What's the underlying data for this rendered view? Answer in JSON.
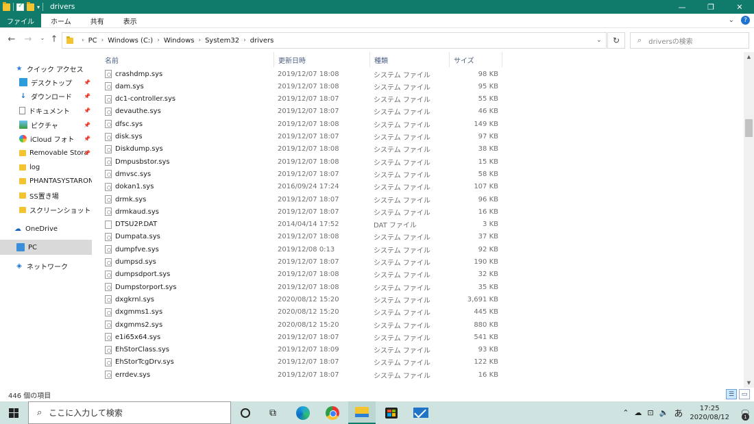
{
  "window": {
    "title": "drivers",
    "minimize": "—",
    "restore": "❐",
    "close": "✕"
  },
  "ribbon": {
    "tabs": [
      "ファイル",
      "ホーム",
      "共有",
      "表示"
    ]
  },
  "address": {
    "crumbs": [
      "PC",
      "Windows (C:)",
      "Windows",
      "System32",
      "drivers"
    ],
    "search_placeholder": "driversの検索"
  },
  "sidebar": {
    "items": [
      {
        "label": "クイック アクセス",
        "icon": "star-icon"
      },
      {
        "label": "デスクトップ",
        "icon": "desktop-icon",
        "pinned": true
      },
      {
        "label": "ダウンロード",
        "icon": "download-icon",
        "pinned": true
      },
      {
        "label": "ドキュメント",
        "icon": "document-icon",
        "pinned": true
      },
      {
        "label": "ピクチャ",
        "icon": "pictures-icon",
        "pinned": true
      },
      {
        "label": "iCloud フォト",
        "icon": "icloud-photos-icon",
        "pinned": true
      },
      {
        "label": "Removable Stora",
        "icon": "folder-icon",
        "pinned": true
      },
      {
        "label": "log",
        "icon": "folder-icon"
      },
      {
        "label": "PHANTASYSTARON",
        "icon": "folder-icon"
      },
      {
        "label": "SS置き場",
        "icon": "folder-icon"
      },
      {
        "label": "スクリーンショット",
        "icon": "folder-icon"
      },
      {
        "label": "OneDrive",
        "icon": "onedrive-icon"
      },
      {
        "label": "PC",
        "icon": "pc-icon",
        "selected": true
      },
      {
        "label": "ネットワーク",
        "icon": "network-icon"
      }
    ]
  },
  "columns": {
    "name": "名前",
    "date": "更新日時",
    "type": "種類",
    "size": "サイズ"
  },
  "files": [
    {
      "name": "crashdmp.sys",
      "date": "2019/12/07 18:08",
      "type": "システム ファイル",
      "size": "98 KB"
    },
    {
      "name": "dam.sys",
      "date": "2019/12/07 18:08",
      "type": "システム ファイル",
      "size": "95 KB"
    },
    {
      "name": "dc1-controller.sys",
      "date": "2019/12/07 18:07",
      "type": "システム ファイル",
      "size": "55 KB"
    },
    {
      "name": "devauthe.sys",
      "date": "2019/12/07 18:07",
      "type": "システム ファイル",
      "size": "46 KB"
    },
    {
      "name": "dfsc.sys",
      "date": "2019/12/07 18:08",
      "type": "システム ファイル",
      "size": "149 KB"
    },
    {
      "name": "disk.sys",
      "date": "2019/12/07 18:07",
      "type": "システム ファイル",
      "size": "97 KB"
    },
    {
      "name": "Diskdump.sys",
      "date": "2019/12/07 18:08",
      "type": "システム ファイル",
      "size": "38 KB"
    },
    {
      "name": "Dmpusbstor.sys",
      "date": "2019/12/07 18:08",
      "type": "システム ファイル",
      "size": "15 KB"
    },
    {
      "name": "dmvsc.sys",
      "date": "2019/12/07 18:07",
      "type": "システム ファイル",
      "size": "58 KB"
    },
    {
      "name": "dokan1.sys",
      "date": "2016/09/24 17:24",
      "type": "システム ファイル",
      "size": "107 KB"
    },
    {
      "name": "drmk.sys",
      "date": "2019/12/07 18:07",
      "type": "システム ファイル",
      "size": "96 KB"
    },
    {
      "name": "drmkaud.sys",
      "date": "2019/12/07 18:07",
      "type": "システム ファイル",
      "size": "16 KB"
    },
    {
      "name": "DTSU2P.DAT",
      "date": "2014/04/14 17:52",
      "type": "DAT ファイル",
      "size": "3 KB",
      "plain": true
    },
    {
      "name": "Dumpata.sys",
      "date": "2019/12/07 18:08",
      "type": "システム ファイル",
      "size": "37 KB"
    },
    {
      "name": "dumpfve.sys",
      "date": "2019/12/08 0:13",
      "type": "システム ファイル",
      "size": "92 KB"
    },
    {
      "name": "dumpsd.sys",
      "date": "2019/12/07 18:07",
      "type": "システム ファイル",
      "size": "190 KB"
    },
    {
      "name": "dumpsdport.sys",
      "date": "2019/12/07 18:08",
      "type": "システム ファイル",
      "size": "32 KB"
    },
    {
      "name": "Dumpstorport.sys",
      "date": "2019/12/07 18:08",
      "type": "システム ファイル",
      "size": "35 KB"
    },
    {
      "name": "dxgkrnl.sys",
      "date": "2020/08/12 15:20",
      "type": "システム ファイル",
      "size": "3,691 KB"
    },
    {
      "name": "dxgmms1.sys",
      "date": "2020/08/12 15:20",
      "type": "システム ファイル",
      "size": "445 KB"
    },
    {
      "name": "dxgmms2.sys",
      "date": "2020/08/12 15:20",
      "type": "システム ファイル",
      "size": "880 KB"
    },
    {
      "name": "e1i65x64.sys",
      "date": "2019/12/07 18:07",
      "type": "システム ファイル",
      "size": "541 KB"
    },
    {
      "name": "EhStorClass.sys",
      "date": "2019/12/07 18:09",
      "type": "システム ファイル",
      "size": "93 KB"
    },
    {
      "name": "EhStorTcgDrv.sys",
      "date": "2019/12/07 18:07",
      "type": "システム ファイル",
      "size": "122 KB"
    },
    {
      "name": "errdev.sys",
      "date": "2019/12/07 18:07",
      "type": "システム ファイル",
      "size": "16 KB"
    }
  ],
  "status": {
    "item_count": "446 個の項目"
  },
  "taskbar": {
    "search_placeholder": "ここに入力して検索",
    "ime": "あ",
    "time": "17:25",
    "date": "2020/08/12",
    "notification_count": "1"
  }
}
